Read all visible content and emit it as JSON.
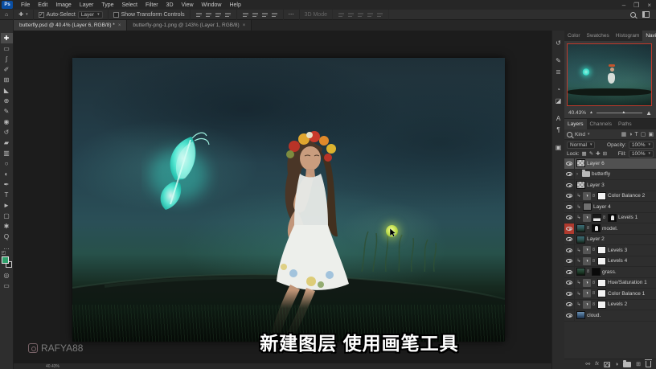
{
  "titlebar": {
    "logo": "Ps",
    "menus": [
      "File",
      "Edit",
      "Image",
      "Layer",
      "Type",
      "Select",
      "Filter",
      "3D",
      "View",
      "Window",
      "Help"
    ],
    "controls": {
      "minimize": "–",
      "restore": "❐",
      "close": "×"
    }
  },
  "options": {
    "auto_select_label": "Auto-Select",
    "auto_select_checked": "✓",
    "layer_dropdown_value": "Layer",
    "show_transform_label": "Show Transform Controls",
    "more_glyph": "⋯",
    "mode_label": "3D Mode"
  },
  "tabs": [
    {
      "label": "butterfly.psd @ 40.4% (Layer 6, RGB/8) *",
      "close": "×"
    },
    {
      "label": "butterfly-png-1.png @ 143% (Layer 1, RGB/8)",
      "close": "×"
    }
  ],
  "toolbar": {
    "tools": [
      {
        "name": "move-tool",
        "glyph": "✚"
      },
      {
        "name": "marquee-tool",
        "glyph": "▭"
      },
      {
        "name": "lasso-tool",
        "glyph": "ʃ"
      },
      {
        "name": "quick-selection-tool",
        "glyph": "✐"
      },
      {
        "name": "crop-tool",
        "glyph": "⊞"
      },
      {
        "name": "eyedropper-tool",
        "glyph": "◣"
      },
      {
        "name": "healing-brush-tool",
        "glyph": "⊕"
      },
      {
        "name": "brush-tool",
        "glyph": "✎"
      },
      {
        "name": "clone-stamp-tool",
        "glyph": "◉"
      },
      {
        "name": "history-brush-tool",
        "glyph": "↺"
      },
      {
        "name": "eraser-tool",
        "glyph": "▰"
      },
      {
        "name": "gradient-tool",
        "glyph": "▥"
      },
      {
        "name": "blur-tool",
        "glyph": "○"
      },
      {
        "name": "dodge-tool",
        "glyph": "◐"
      },
      {
        "name": "pen-tool",
        "glyph": "✒"
      },
      {
        "name": "type-tool",
        "glyph": "T"
      },
      {
        "name": "path-selection-tool",
        "glyph": "►"
      },
      {
        "name": "shape-tool",
        "glyph": "▢"
      },
      {
        "name": "hand-tool",
        "glyph": "✱"
      },
      {
        "name": "zoom-tool",
        "glyph": "Q"
      },
      {
        "name": "edit-toolbar",
        "glyph": "…"
      }
    ],
    "foreground_color": "#2ea06b",
    "background_color": "#1c1c1c"
  },
  "document": {
    "subtitle": "新建图层 使用画笔工具",
    "watermark": "RAFYA88",
    "status_zoom": "40.43%"
  },
  "dock_icons": [
    {
      "name": "history-panel-icon",
      "glyph": "↺"
    },
    {
      "name": "brush-settings-panel-icon",
      "glyph": "✎"
    },
    {
      "name": "clone-source-panel-icon",
      "glyph": "≣"
    },
    {
      "name": "adjustments-panel-icon",
      "glyph": "◔"
    },
    {
      "name": "styles-panel-icon",
      "glyph": "◪"
    },
    {
      "name": "character-panel-icon",
      "glyph": "A"
    },
    {
      "name": "paragraph-panel-icon",
      "glyph": "¶"
    },
    {
      "name": "libraries-panel-icon",
      "glyph": "▣"
    }
  ],
  "panel": {
    "top_tabs": [
      "Color",
      "Swatches",
      "Histogram",
      "Navigator"
    ],
    "navigator_zoom": "40.43%",
    "layer_tabs": [
      "Layers",
      "Channels",
      "Paths"
    ],
    "filter_kind": "Kind",
    "filter_icons": [
      "▦",
      "◑",
      "T",
      "▢",
      "▣"
    ],
    "blend_mode": "Normal",
    "opacity_label": "Opacity:",
    "opacity_value": "100%",
    "lock_label": "Lock:",
    "lock_icons": [
      "▦",
      "✎",
      "✚",
      "⊞"
    ],
    "fill_label": "Fill:",
    "fill_value": "100%",
    "layers": [
      {
        "name": "Layer 6"
      },
      {
        "name": "butterfly"
      },
      {
        "name": "Layer 3"
      },
      {
        "name": "Color Balance 2"
      },
      {
        "name": "Layer 4"
      },
      {
        "name": "Levels 1"
      },
      {
        "name": "model."
      },
      {
        "name": "Layer 2"
      },
      {
        "name": "Levels 3"
      },
      {
        "name": "Levels 4"
      },
      {
        "name": "grass."
      },
      {
        "name": "Hue/Saturation 1"
      },
      {
        "name": "Color Balance 1"
      },
      {
        "name": "Levels 2"
      },
      {
        "name": "cloud."
      }
    ]
  }
}
